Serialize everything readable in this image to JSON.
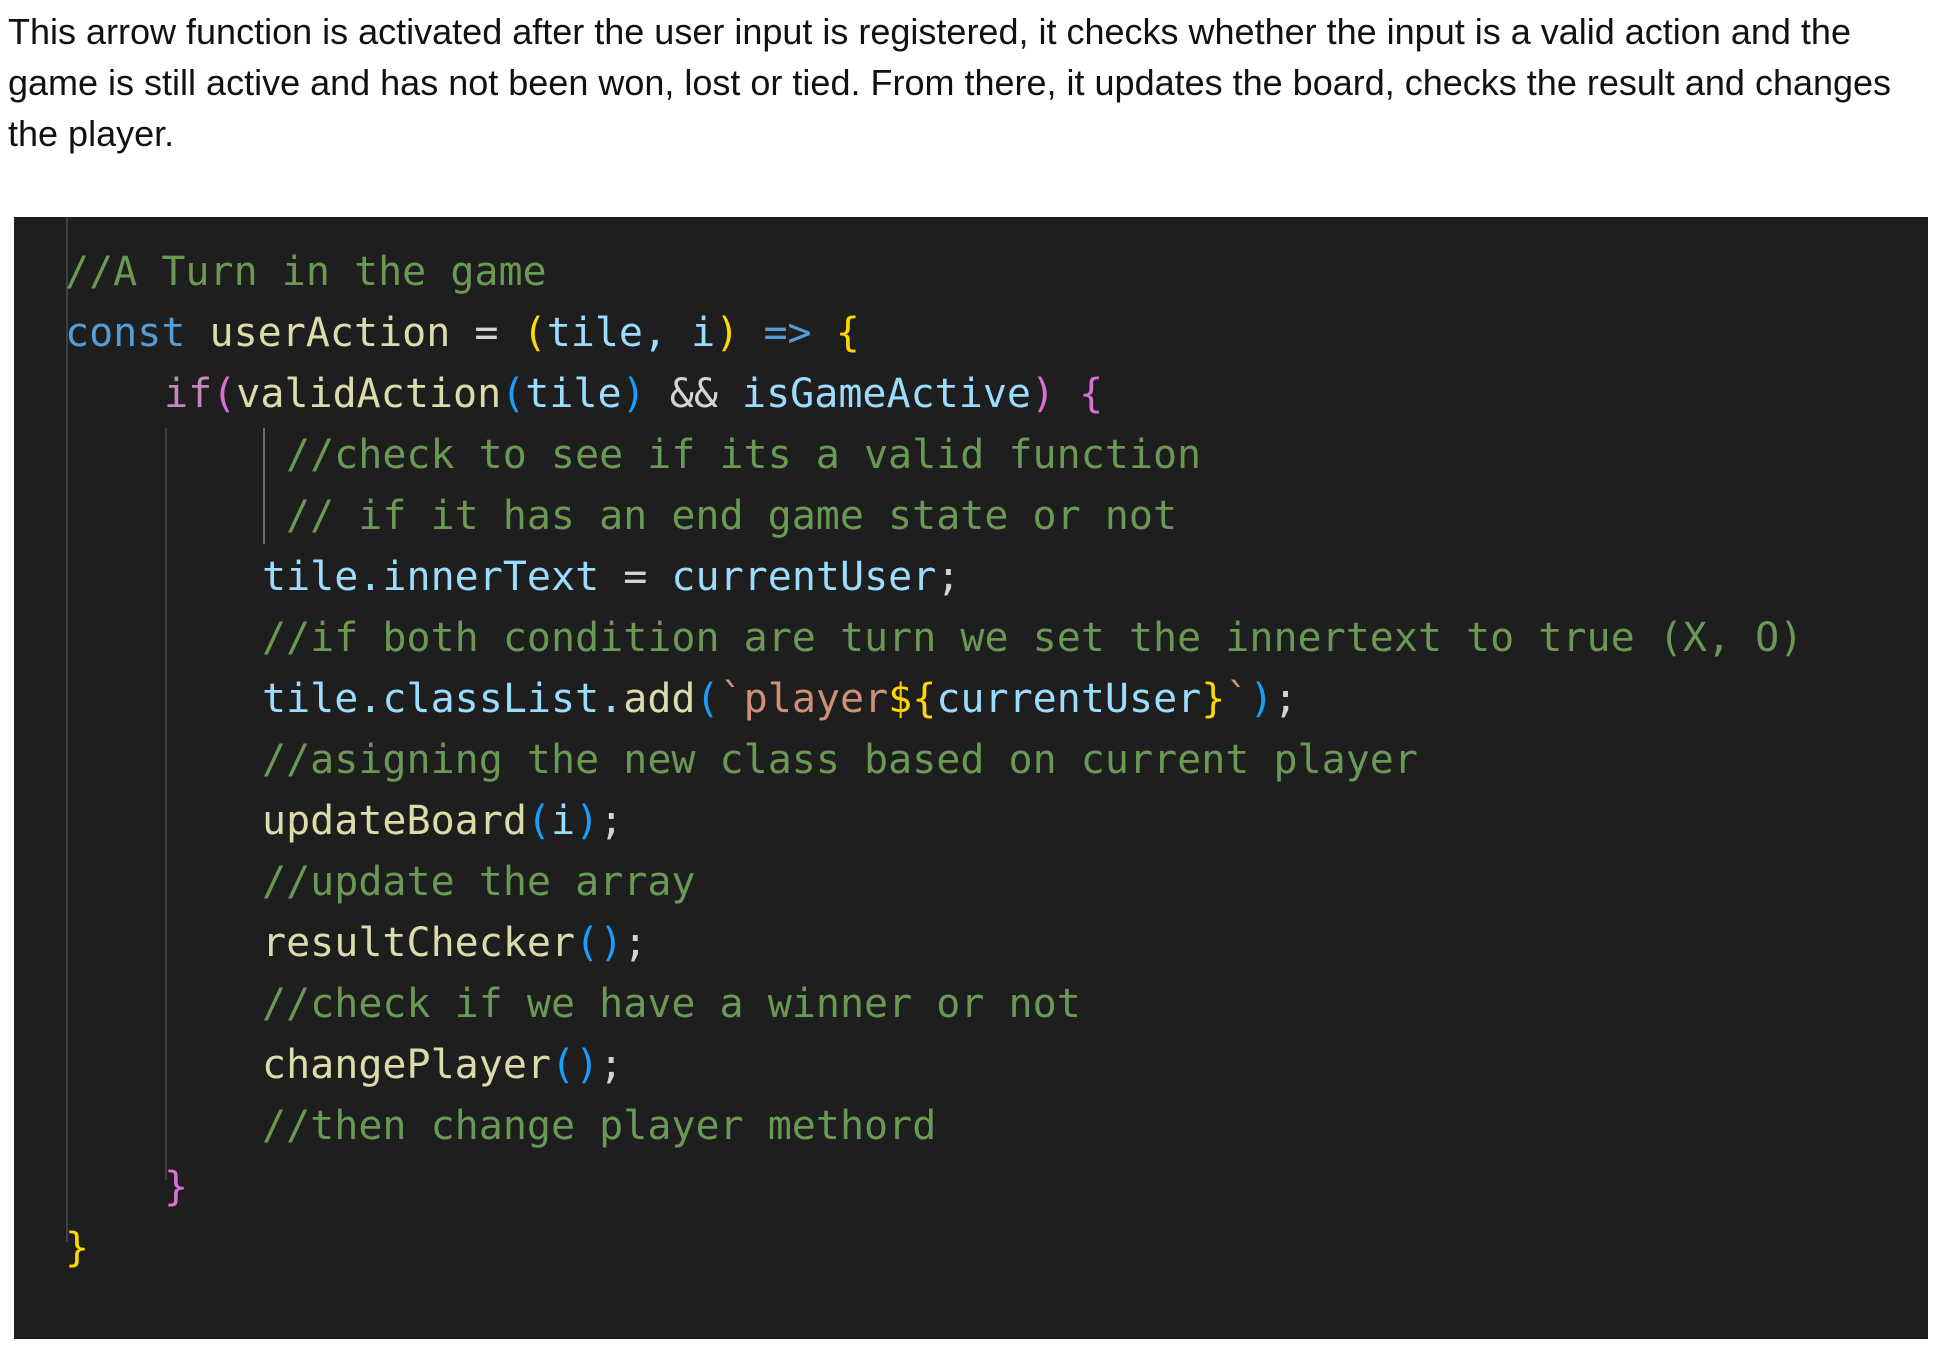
{
  "intro_text": "This arrow function is activated after the user input is registered, it checks whether the input is a valid action and the game is still active and has not been won, lost or tied. From there, it updates the board, checks the result and changes the player.",
  "code": {
    "line1": "//A Turn in the game",
    "line2": {
      "kw": "const",
      "name": "userAction",
      "eq": " = ",
      "open": "(",
      "params": "tile, i",
      "close": ")",
      "arrow": " => ",
      "brace": "{"
    },
    "line3": {
      "kw": "if",
      "open": "(",
      "fn": "validAction",
      "p_open": "(",
      "arg": "tile",
      "p_close": ")",
      "and": " && ",
      "var": "isGameActive",
      "close": ")",
      "brace": " {"
    },
    "line4": "//check to see if its a valid function",
    "line5": "// if it has an end game state or not",
    "line6": {
      "obj": "tile",
      "prop": ".innerText",
      "eq": " = ",
      "val": "currentUser",
      "semi": ";"
    },
    "line7": "//if both condition are turn we set the innertext to true (X, O)",
    "line8": {
      "obj": "tile",
      "prop": ".classList.",
      "fn": "add",
      "open": "(",
      "str_start": "`player",
      "tpl_open": "${",
      "tpl_var": "currentUser",
      "tpl_close": "}",
      "str_end": "`",
      "close": ")",
      "semi": ";"
    },
    "line9": "//asigning the new class based on current player",
    "line10": {
      "fn": "updateBoard",
      "open": "(",
      "arg": "i",
      "close": ")",
      "semi": ";"
    },
    "line11": "//update the array",
    "line12": {
      "fn": "resultChecker",
      "parens": "()",
      "semi": ";"
    },
    "line13": "//check if we have a winner or not",
    "line14": {
      "fn": "changePlayer",
      "parens": "()",
      "semi": ";"
    },
    "line15": "//then change player methord",
    "line16": "}",
    "line17": "}"
  },
  "colors": {
    "background": "#1e1e1e",
    "comment": "#6a9955",
    "keyword": "#569cd6",
    "control": "#c586c0",
    "variable": "#9cdcfe",
    "function": "#dcdcaa",
    "string": "#ce9178",
    "bracket_gold": "#ffd700",
    "bracket_orchid": "#da70d6",
    "bracket_blue": "#179fff"
  }
}
